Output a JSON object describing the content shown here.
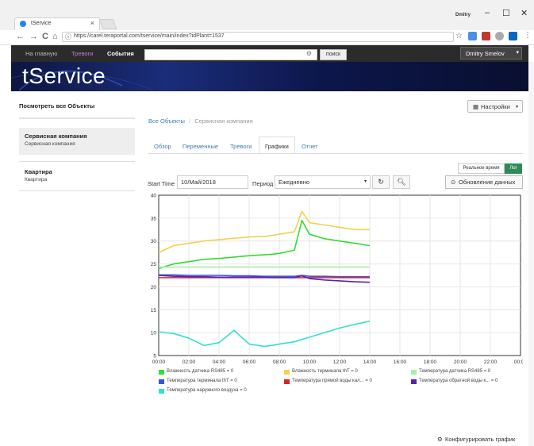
{
  "browser": {
    "tab_title": "tService",
    "tab_close": "×",
    "user": "Dmitry",
    "url": "https://carel.teraportal.com/tservice/main/index?idPlant=1537",
    "win_min": "–",
    "win_max": "☐",
    "win_close": "✕",
    "nav_back": "←",
    "nav_forward": "→",
    "nav_reload": "C",
    "nav_home": "⌂",
    "star": "☆"
  },
  "topnav": {
    "home": "На главную",
    "alarms": "Тревоги",
    "events": "События",
    "search_placeholder": "",
    "search_button": "поиск",
    "user_button": "Dmitry Smelov"
  },
  "banner": {
    "logo": "tService"
  },
  "sidebar": {
    "all_objects": "Посмотреть все Объекты",
    "items": [
      {
        "title": "Сервисная компания",
        "sub": "Сервисная компания"
      },
      {
        "title": "Квартира",
        "sub": "Квартира"
      }
    ]
  },
  "main": {
    "settings_button": "Настройки",
    "breadcrumb": {
      "root": "Все Объекты",
      "sep": "/",
      "current": "Сервисная компания"
    },
    "tabs": [
      "Обзор",
      "Переменные",
      "Тревоги",
      "Графики",
      "Отчет"
    ],
    "realtime_label": "Реальное время",
    "log_label": "Лог",
    "start_time_label": "Start Time",
    "start_time_value": "10/Май/2018",
    "period_label": "Период",
    "period_value": "Ежедневно",
    "update_button": "Обновление данных",
    "configure_button": "Конфигурировать график"
  },
  "chart_data": {
    "type": "line",
    "ylim": [
      5,
      40
    ],
    "yticks": [
      5,
      10,
      15,
      20,
      25,
      30,
      35,
      40
    ],
    "xticks": [
      "00:00",
      "02:00",
      "04:00",
      "06:00",
      "08:00",
      "10:00",
      "12:00",
      "14:00",
      "16:00",
      "18:00",
      "20:00",
      "22:00",
      "00:00"
    ],
    "x_hours": [
      0,
      1,
      2,
      3,
      4,
      5,
      6,
      7,
      7.5,
      8,
      9,
      9.5,
      10,
      11,
      12,
      13,
      14
    ],
    "series": [
      {
        "name": "Влажность датчика RS485 = 0",
        "color": "#33dd33",
        "values": [
          24,
          25,
          25.5,
          26,
          26.2,
          26.5,
          26.8,
          27,
          27.1,
          27.3,
          28,
          34.5,
          31.5,
          30.5,
          30,
          29.5,
          29
        ]
      },
      {
        "name": "Влажность терминала thT = 0",
        "color": "#f2d24a",
        "values": [
          27.5,
          29,
          29.5,
          30,
          30.3,
          30.6,
          30.9,
          31,
          31.2,
          31.5,
          32,
          36.5,
          34,
          33.5,
          33,
          32.5,
          32.5
        ]
      },
      {
        "name": "Температура датчика RS485 = 0",
        "color": "#a8eea8",
        "values": [
          24.3,
          24.3,
          24.3,
          24.3,
          24.3,
          24.3,
          24.3,
          24.3,
          24.3,
          24.3,
          24.3,
          24.3,
          24.3,
          24.3,
          24.3,
          24.3,
          24.3
        ]
      },
      {
        "name": "Температура терминала thT = 0",
        "color": "#3355dd",
        "values": [
          22.6,
          22.6,
          22.5,
          22.5,
          22.5,
          22.4,
          22.4,
          22.3,
          22.3,
          22.3,
          22.3,
          22.5,
          22.3,
          22.3,
          22.2,
          22.2,
          22.2
        ]
      },
      {
        "name": "Температура прямой воды кал... = 0",
        "color": "#dd2222",
        "values": [
          22,
          22,
          22,
          22,
          22,
          22,
          22,
          22,
          22,
          22,
          22,
          22,
          22,
          22,
          22,
          22,
          22
        ]
      },
      {
        "name": "Температура обратной воды к... = 0",
        "color": "#5522bb",
        "values": [
          22.5,
          22.3,
          22.2,
          22.2,
          22.1,
          22.1,
          22.1,
          22.1,
          22,
          22,
          22,
          22.4,
          21.8,
          21.5,
          21.3,
          21.1,
          21
        ]
      },
      {
        "name": "Температура наружного воздуха = 0",
        "color": "#33e0d0",
        "values": [
          10.2,
          9.8,
          8.8,
          7.2,
          7.8,
          10.5,
          7.5,
          7,
          7.2,
          7.5,
          8,
          8.5,
          9,
          10,
          11,
          11.8,
          12.5
        ]
      }
    ]
  }
}
